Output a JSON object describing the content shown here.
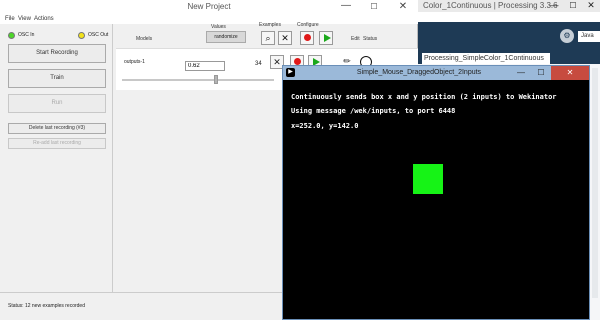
{
  "processing": {
    "title": "Color_1Continuous | Processing 3.3.6",
    "min": "—",
    "max": "☐",
    "close": "✕",
    "debug_icon": "⚙",
    "mode_label": "Java",
    "tab_label": "Processing_SimpleColor_1Continuous"
  },
  "wekinator": {
    "title": "New Project",
    "window_min": "—",
    "window_max": "☐",
    "window_close": "✕",
    "menu": [
      "File",
      "View",
      "Actions"
    ],
    "osc_in_label": "OSC In",
    "osc_out_label": "OSC Out",
    "osc_in_color": "#4cd628",
    "osc_out_color": "#f2e21a",
    "start_recording": "Start Recording",
    "train": "Train",
    "run": "Run",
    "delete_last": "Delete last recording (#3)",
    "readd_last": "Re-add last recording",
    "headers": {
      "models": "Models",
      "values": "Values",
      "randomize": "randomize",
      "examples": "Examples",
      "configure": "Configure",
      "edit": "Edit",
      "status": "Status"
    },
    "toolbar_icons": {
      "search": "⌕",
      "delete": "✕"
    },
    "model": {
      "name": "outputs-1",
      "value": "0.62",
      "examples": "34",
      "delete_icon": "✕",
      "edit_icon": "✏"
    },
    "status_text": "Status:   12 new examples recorded"
  },
  "sketch": {
    "title": "Simple_Mouse_DraggedObject_2Inputs",
    "app_icon": "▶",
    "min": "—",
    "max": "☐",
    "close": "✕",
    "line1": "Continuously sends box x and y position (2 inputs) to Wekinator",
    "line2": "Using message /wek/inputs, to port 6448",
    "line3": "x=252.0, y=142.0",
    "box_color": "#16f316"
  }
}
